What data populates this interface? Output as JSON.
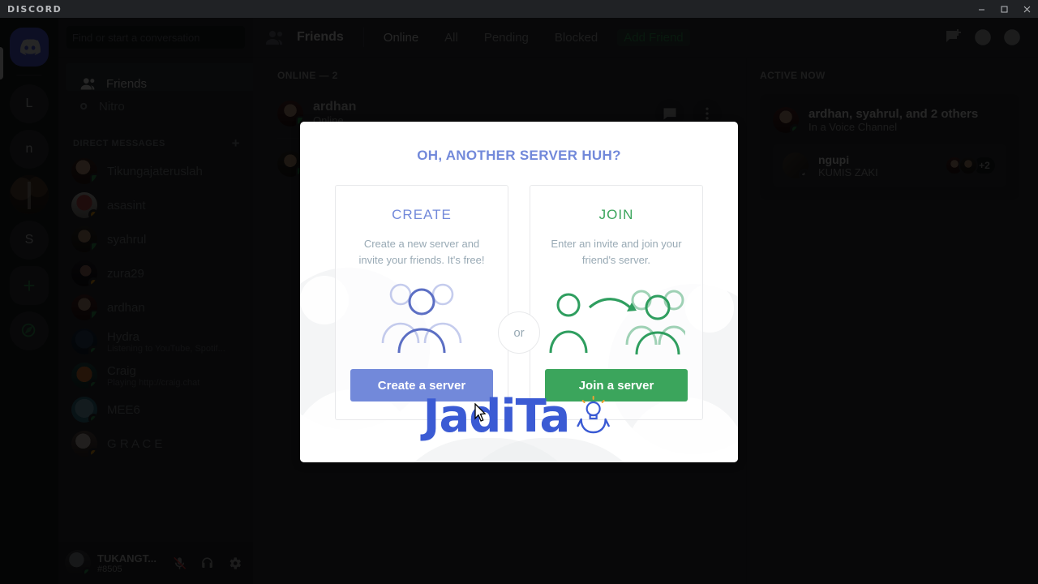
{
  "titlebar": {
    "wordmark": "DISCORD",
    "minimize": "minimize-window",
    "maximize": "maximize-window",
    "close": "close-window"
  },
  "rail": {
    "items": [
      {
        "name": "home",
        "label": "",
        "icon": "discord-home-icon",
        "selected": true
      },
      {
        "name": "guild-l",
        "label": "L"
      },
      {
        "name": "guild-n",
        "label": "n"
      },
      {
        "name": "guild-image",
        "label": ""
      },
      {
        "name": "guild-s",
        "label": "S"
      },
      {
        "name": "add-server",
        "label": "+"
      },
      {
        "name": "explore",
        "label": ""
      }
    ]
  },
  "sidebar": {
    "search_placeholder": "Find or start a conversation",
    "nav": [
      {
        "label": "Friends",
        "icon": "friends-icon",
        "active": true
      },
      {
        "label": "Nitro",
        "icon": "nitro-icon",
        "active": false
      }
    ],
    "dm_header": "DIRECT MESSAGES",
    "dm_add": "+",
    "dms": [
      {
        "name": "Tikungajateruslah",
        "sub": "",
        "status": "mobile"
      },
      {
        "name": "asasint",
        "sub": "",
        "status": "idle"
      },
      {
        "name": "syahrul",
        "sub": "",
        "status": "mobile"
      },
      {
        "name": "zura29",
        "sub": "",
        "status": "idle"
      },
      {
        "name": "ardhan",
        "sub": "",
        "status": "mobile"
      },
      {
        "name": "Hydra",
        "sub": "Listening to YouTube, Spotif...",
        "status": "online"
      },
      {
        "name": "Craig",
        "sub": "Playing http://craig.chat",
        "status": "online"
      },
      {
        "name": "MEE6",
        "sub": "",
        "status": "online"
      },
      {
        "name": "G R A C E",
        "sub": "",
        "status": "idle"
      }
    ],
    "user": {
      "name": "TUKANGT...",
      "tag": "#8505",
      "mic": "mic-muted-icon",
      "headset": "headset-icon",
      "settings": "settings-gear-icon"
    }
  },
  "topbar": {
    "icon": "friends-icon",
    "title": "Friends",
    "tabs": [
      {
        "label": "Online",
        "active": true
      },
      {
        "label": "All",
        "active": false
      },
      {
        "label": "Pending",
        "active": false
      },
      {
        "label": "Blocked",
        "active": false
      }
    ],
    "add_friend": "Add Friend",
    "right_icons": [
      {
        "name": "new-group-dm-icon"
      },
      {
        "name": "mentions-icon"
      },
      {
        "name": "help-icon"
      }
    ]
  },
  "friends": {
    "section_title": "ONLINE — 2",
    "rows": [
      {
        "name": "ardhan",
        "status": "Online",
        "presence": "mobile"
      },
      {
        "name": "",
        "status": "",
        "presence": "mobile"
      }
    ],
    "actions": [
      "message-icon",
      "more-options-icon"
    ]
  },
  "active_now": {
    "title": "ACTIVE NOW",
    "card": {
      "title": "ardhan, syahrul, and 2 others",
      "subtitle": "In a Voice Channel",
      "channel_name": "ngupi",
      "channel_sub": "KUMIS ZAKI",
      "overflow": "+2"
    }
  },
  "modal": {
    "title": "OH, ANOTHER SERVER HUH?",
    "divider": "or",
    "watermark": "JadiTa",
    "cards": [
      {
        "heading": "CREATE",
        "body": "Create a new server and invite your friends. It's free!",
        "button": "Create a server",
        "color": "#7289da",
        "illustration": "group-of-people-icon"
      },
      {
        "heading": "JOIN",
        "body": "Enter an invite and join your friend's server.",
        "button": "Join a server",
        "color": "#3ba55c",
        "illustration": "person-joining-group-icon"
      }
    ]
  },
  "colors": {
    "blurple": "#7289da",
    "green": "#3ba55c",
    "dark": "#202225",
    "sidebar": "#2f3136",
    "main": "#36393f"
  }
}
